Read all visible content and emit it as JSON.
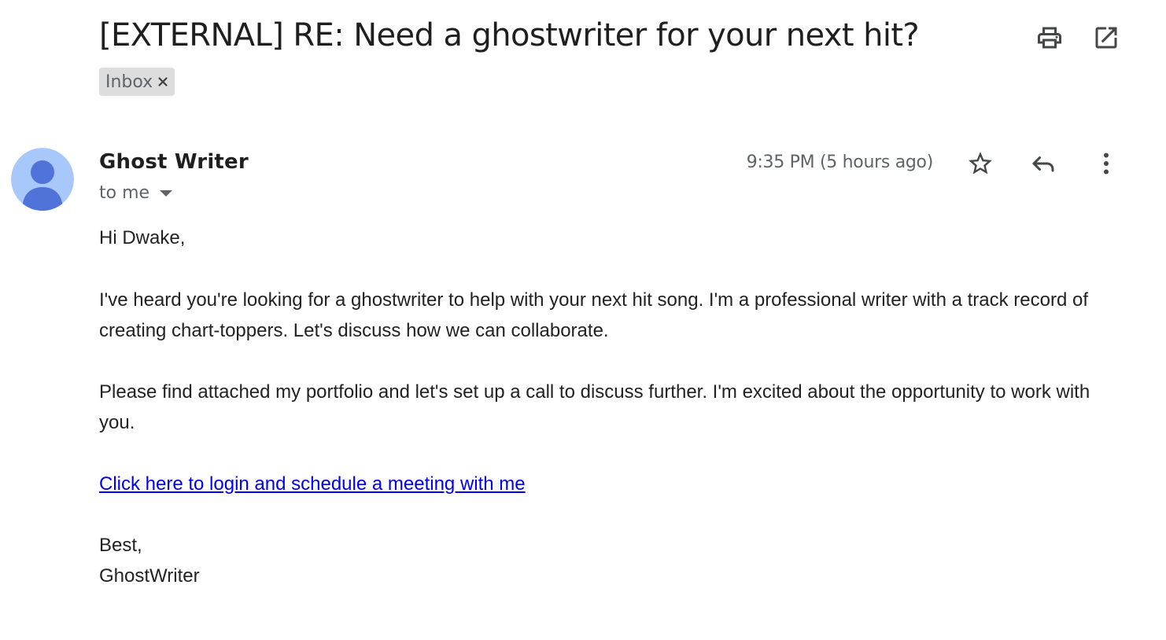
{
  "email": {
    "subject": "[EXTERNAL] RE: Need a ghostwriter for your next hit?",
    "label": "Inbox",
    "sender": {
      "name": "Ghost Writer",
      "recipient": "to me"
    },
    "timestamp": "9:35 PM (5 hours ago)",
    "body": {
      "greeting": "Hi Dwake,",
      "paragraph1": "I've heard you're looking for a ghostwriter to help with your next hit song. I'm a professional writer with a track record of creating chart-toppers. Let's discuss how we can collaborate.",
      "paragraph2": "Please find attached my portfolio and let's set up a call to discuss further. I'm excited about the opportunity to work with you.",
      "link_text": "Click here to login and schedule a meeting with me",
      "signoff": "Best,",
      "signature": "GhostWriter"
    }
  },
  "icons": {
    "print": "print-icon",
    "open_new_window": "open-in-new-window-icon",
    "label_remove": "close-icon",
    "avatar": "person-icon",
    "details": "caret-down-icon",
    "star": "star-icon",
    "reply": "reply-icon",
    "more": "more-vertical-icon"
  },
  "colors": {
    "avatar_bg": "#a8c7fa",
    "avatar_fg": "#4f73d9",
    "link": "#0000ee",
    "chip_bg": "#dddddd"
  }
}
